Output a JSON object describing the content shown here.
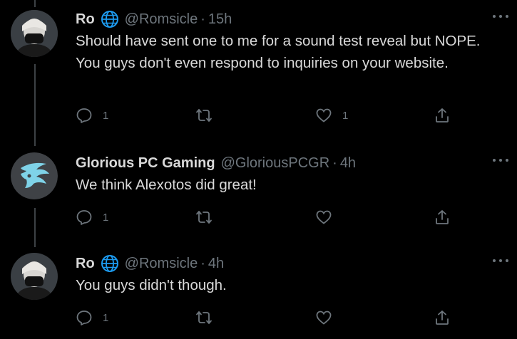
{
  "colors": {
    "background": "#000000",
    "text": "#d9d9d9",
    "secondary": "#6e767d",
    "thread_line": "#3d4145"
  },
  "tweets": [
    {
      "name": "Ro",
      "verified_icon": "globe-icon",
      "handle": "@Romsicle",
      "separator": "·",
      "time": "15h",
      "text": "Should have sent one to me for a sound test reveal but NOPE. You guys don't even respond to inquiries on your website.",
      "reply_count": "1",
      "retweet_count": "",
      "like_count": "1"
    },
    {
      "name": "Glorious PC Gaming",
      "handle": "@GloriousPCGR",
      "separator": "·",
      "time": "4h",
      "text": "We think Alexotos did great!",
      "reply_count": "1",
      "retweet_count": "",
      "like_count": ""
    },
    {
      "name": "Ro",
      "verified_icon": "globe-icon",
      "handle": "@Romsicle",
      "separator": "·",
      "time": "4h",
      "text": "You guys didn't though.",
      "reply_count": "1",
      "retweet_count": "",
      "like_count": ""
    }
  ]
}
